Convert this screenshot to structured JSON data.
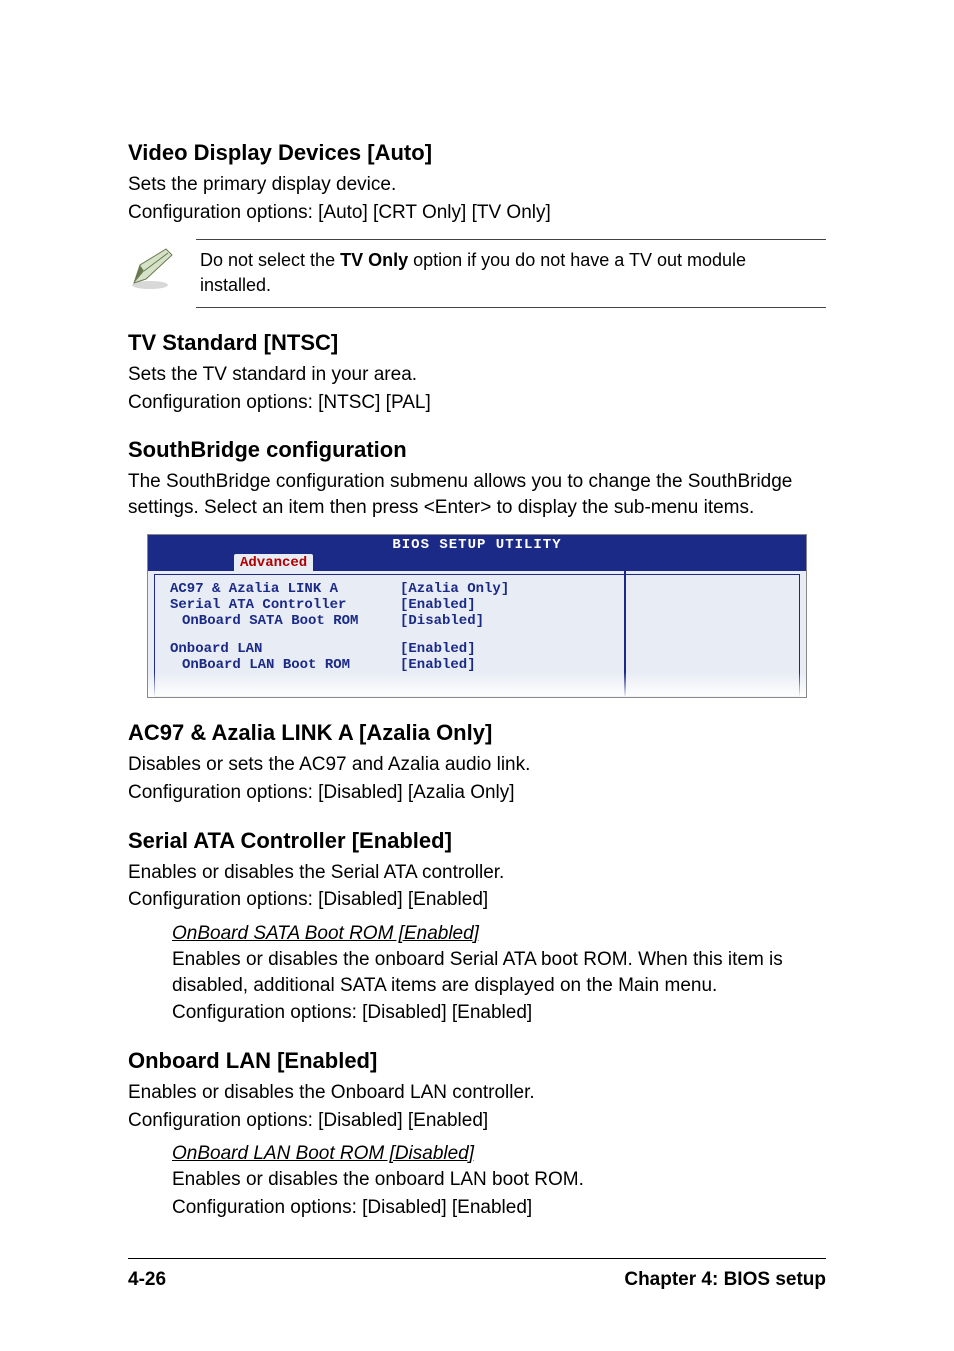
{
  "sections": {
    "video": {
      "title": "Video Display Devices [Auto]",
      "line1": "Sets the primary display device.",
      "line2": "Configuration options: [Auto] [CRT Only] [TV Only]"
    },
    "note": {
      "pre": "Do not select the ",
      "bold": "TV Only",
      "post": " option if you do not have a TV out module installed."
    },
    "tv": {
      "title": "TV Standard [NTSC]",
      "line1": "Sets the TV standard  in your area.",
      "line2": "Configuration options: [NTSC] [PAL]"
    },
    "south": {
      "title": "SouthBridge configuration",
      "desc": "The SouthBridge configuration submenu allows you to change the SouthBridge settings. Select an item then press <Enter> to display the sub-menu items."
    },
    "bios": {
      "header": "BIOS SETUP UTILITY",
      "tab": "Advanced",
      "rows": [
        {
          "k": "AC97 & Azalia LINK A",
          "v": "[Azalia Only]",
          "indent": false
        },
        {
          "k": "Serial ATA Controller",
          "v": "[Enabled]",
          "indent": false
        },
        {
          "k": "OnBoard SATA Boot ROM",
          "v": "[Disabled]",
          "indent": true
        },
        {
          "gap": true
        },
        {
          "k": "Onboard LAN",
          "v": "[Enabled]",
          "indent": false
        },
        {
          "k": "OnBoard LAN Boot ROM",
          "v": "[Enabled]",
          "indent": true
        }
      ]
    },
    "ac97": {
      "title": "AC97 & Azalia LINK A [Azalia Only]",
      "line1": "Disables or sets the AC97 and Azalia audio link.",
      "line2": "Configuration options: [Disabled] [Azalia Only]"
    },
    "sata": {
      "title": "Serial ATA Controller [Enabled]",
      "line1": "Enables or disables the Serial ATA controller.",
      "line2": "Configuration options: [Disabled] [Enabled]",
      "sub": {
        "title": "OnBoard SATA Boot ROM [Enabled]",
        "line1": "Enables or disables the onboard Serial ATA boot ROM. When this item is disabled, additional SATA items are displayed on the Main menu.",
        "line2": "Configuration options: [Disabled] [Enabled]"
      }
    },
    "lan": {
      "title": "Onboard LAN [Enabled]",
      "line1": "Enables or disables the Onboard LAN controller.",
      "line2": "Configuration options: [Disabled] [Enabled]",
      "sub": {
        "title": "OnBoard LAN Boot ROM [Disabled]",
        "line1": "Enables or disables the onboard LAN boot ROM.",
        "line2": "Configuration options: [Disabled] [Enabled]"
      }
    }
  },
  "footer": {
    "left": "4-26",
    "right": "Chapter 4: BIOS setup"
  }
}
